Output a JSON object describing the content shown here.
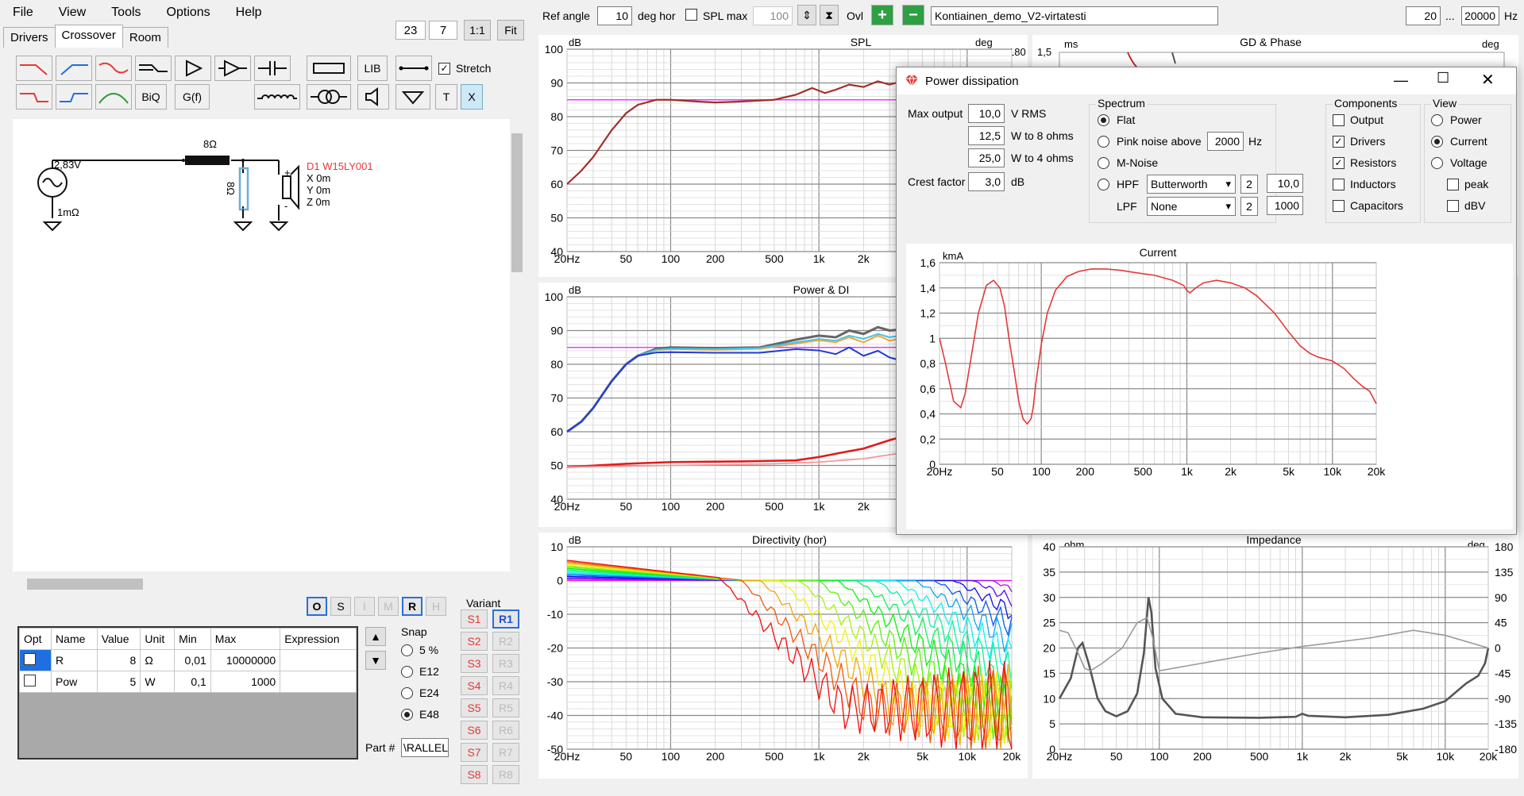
{
  "menu": [
    "File",
    "View",
    "Tools",
    "Options",
    "Help"
  ],
  "tabs": [
    "Drivers",
    "Crossover",
    "Room"
  ],
  "zoom": {
    "a": "23",
    "b": "7",
    "one": "1:1",
    "fit": "Fit"
  },
  "toolbar": {
    "lib": "LIB",
    "stretch": "Stretch",
    "biq": "BiQ",
    "gf": "G(f)",
    "t": "T",
    "x": "X"
  },
  "schematic": {
    "resistor_label": "8Ω",
    "source_voltage": "2,83V",
    "source_res": "1mΩ",
    "shunt_label": "8Ω",
    "driver_name": "D1 W15LY001",
    "driver_x": "X 0m",
    "driver_y": "Y 0m",
    "driver_z": "Z 0m",
    "plus": "+",
    "minus": "-"
  },
  "mode_buttons": [
    "O",
    "S",
    "I",
    "M",
    "R",
    "H"
  ],
  "table": {
    "headers": [
      "Opt",
      "Name",
      "Value",
      "Unit",
      "Min",
      "Max",
      "Expression"
    ],
    "rows": [
      [
        "",
        "R",
        "8",
        "Ω",
        "0,01",
        "10000000",
        ""
      ],
      [
        "",
        "Pow",
        "5",
        "W",
        "0,1",
        "1000",
        ""
      ]
    ]
  },
  "snap": {
    "title": "Snap",
    "options": [
      "5 %",
      "E12",
      "E24",
      "E48"
    ],
    "selected": "E48"
  },
  "part": {
    "label": "Part #",
    "value": "\\RALLEL"
  },
  "variant": {
    "title": "Variant",
    "s": [
      "S1",
      "S2",
      "S3",
      "S4",
      "S5",
      "S6",
      "S7",
      "S8"
    ],
    "r": [
      "R1",
      "R2",
      "R3",
      "R4",
      "R5",
      "R6",
      "R7",
      "R8"
    ]
  },
  "top": {
    "ref_angle_label": "Ref angle",
    "ref_angle": "10",
    "deg_hor": "deg hor",
    "spl_max_label": "SPL max",
    "spl_max": "100",
    "ovl": "Ovl",
    "project": "Kontiainen_demo_V2-virtatesti",
    "f_low": "20",
    "dots": "...",
    "f_high": "20000",
    "hz": "Hz"
  },
  "charts": {
    "spl": {
      "title": "SPL",
      "unit_l": "dB",
      "unit_r": "deg",
      "r_top": "180",
      "y": [
        "100",
        "90",
        "80",
        "70",
        "60",
        "50",
        "40"
      ],
      "x": [
        "20Hz",
        "50",
        "100",
        "200",
        "500",
        "1k",
        "2k"
      ]
    },
    "gd": {
      "title": "GD & Phase",
      "unit_l": "ms",
      "unit_r": "deg",
      "l_top": "1,5"
    },
    "power": {
      "title": "Power & DI",
      "unit_l": "dB",
      "y": [
        "100",
        "90",
        "80",
        "70",
        "60",
        "50",
        "40"
      ],
      "x": [
        "20Hz",
        "50",
        "100",
        "200",
        "500",
        "1k",
        "2k"
      ]
    },
    "directivity": {
      "title": "Directivity (hor)",
      "unit_l": "dB",
      "y": [
        "10",
        "0",
        "-10",
        "-20",
        "-30",
        "-40",
        "-50"
      ],
      "x": [
        "20Hz",
        "50",
        "100",
        "200",
        "500",
        "1k",
        "2k",
        "5k",
        "10k",
        "20k"
      ]
    },
    "impedance": {
      "title": "Impedance",
      "unit_l": "ohm",
      "unit_r": "deg",
      "y": [
        "40",
        "35",
        "30",
        "25",
        "20",
        "15",
        "10",
        "5",
        "0"
      ],
      "yr": [
        "180",
        "135",
        "90",
        "45",
        "0",
        "-45",
        "-90",
        "-135",
        "-180"
      ],
      "x": [
        "20Hz",
        "50",
        "100",
        "200",
        "500",
        "1k",
        "2k",
        "5k",
        "10k",
        "20k"
      ]
    }
  },
  "dialog": {
    "title": "Power dissipation",
    "max_output_label": "Max output",
    "max_output": "10,0",
    "v_rms": "V  RMS",
    "w8": "12,5",
    "w8_label": "W to 8 ohms",
    "w4": "25,0",
    "w4_label": "W to 4 ohms",
    "crest_label": "Crest factor",
    "crest": "3,0",
    "db": "dB",
    "spectrum_title": "Spectrum",
    "flat": "Flat",
    "pink": "Pink noise above",
    "pink_val": "2000",
    "hz": "Hz",
    "mnoise": "M-Noise",
    "hpf": "HPF",
    "hpf_type": "Butterworth",
    "hpf_order": "2",
    "hpf_freq": "10,0",
    "lpf": "LPF",
    "lpf_type": "None",
    "lpf_order": "2",
    "lpf_freq": "1000",
    "components_title": "Components",
    "components": [
      "Output",
      "Drivers",
      "Resistors",
      "Inductors",
      "Capacitors"
    ],
    "components_checked": [
      false,
      true,
      true,
      false,
      false
    ],
    "view_title": "View",
    "view": [
      "Power",
      "Current",
      "Voltage"
    ],
    "view_selected": "Current",
    "peak": "peak",
    "dbv": "dBV"
  },
  "chart_data": {
    "type": "line",
    "title": "Current",
    "ylabel": "kmA",
    "x_scale": "log",
    "xlim": [
      20,
      20000
    ],
    "ylim": [
      0,
      1.6
    ],
    "x_ticks": [
      "20Hz",
      "50",
      "100",
      "200",
      "500",
      "1k",
      "2k",
      "5k",
      "10k",
      "20k"
    ],
    "y_ticks": [
      "1,6",
      "1,4",
      "1,2",
      "1",
      "0,8",
      "0,6",
      "0,4",
      "0,2",
      "0"
    ],
    "series": [
      {
        "color": "#e53935",
        "x": [
          20,
          22,
          25,
          28,
          30,
          33,
          37,
          42,
          47,
          52,
          56,
          60,
          65,
          70,
          75,
          80,
          85,
          88,
          92,
          100,
          110,
          125,
          150,
          180,
          220,
          280,
          350,
          450,
          600,
          800,
          950,
          1000,
          1050,
          1150,
          1300,
          1600,
          2000,
          2500,
          3000,
          4000,
          5000,
          6000,
          7000,
          8000,
          10000,
          12000,
          14000,
          16000,
          18000,
          20000
        ],
        "values": [
          1.0,
          0.8,
          0.5,
          0.45,
          0.56,
          0.85,
          1.2,
          1.42,
          1.46,
          1.4,
          1.25,
          1.0,
          0.75,
          0.5,
          0.36,
          0.32,
          0.36,
          0.45,
          0.65,
          0.95,
          1.2,
          1.38,
          1.49,
          1.53,
          1.55,
          1.55,
          1.54,
          1.52,
          1.5,
          1.46,
          1.42,
          1.38,
          1.36,
          1.4,
          1.44,
          1.46,
          1.44,
          1.4,
          1.34,
          1.2,
          1.05,
          0.94,
          0.88,
          0.85,
          0.82,
          0.76,
          0.68,
          0.62,
          0.58,
          0.48
        ]
      }
    ]
  }
}
